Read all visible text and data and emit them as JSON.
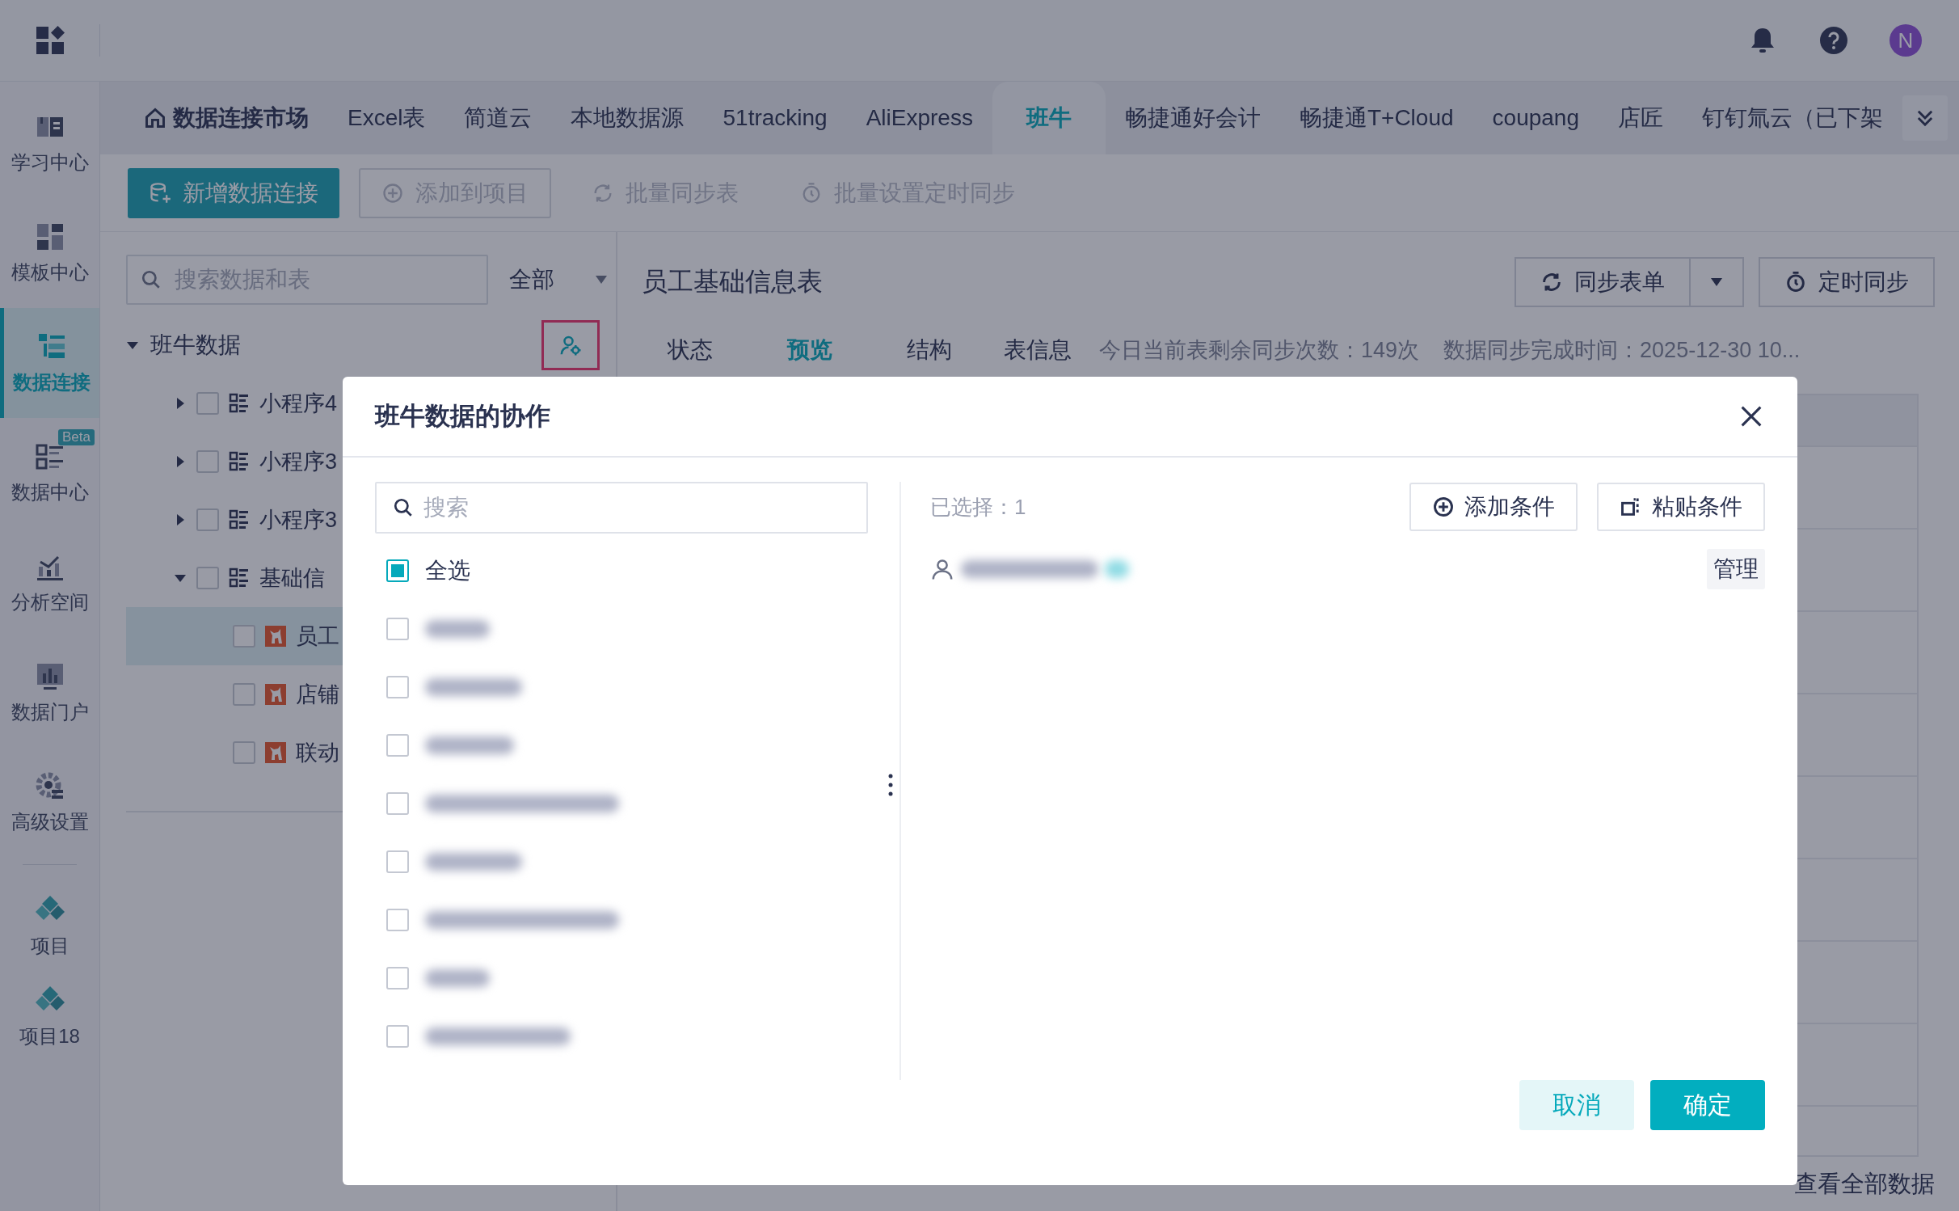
{
  "top_bar": {
    "avatar": "N"
  },
  "sidebar": {
    "items": [
      {
        "label": "学习中心",
        "kind": "nav",
        "selected": false
      },
      {
        "label": "模板中心",
        "kind": "nav",
        "selected": false
      },
      {
        "label": "数据连接",
        "kind": "nav",
        "selected": true
      },
      {
        "label": "数据中心",
        "kind": "nav",
        "selected": false,
        "badge": "Beta"
      },
      {
        "label": "分析空间",
        "kind": "nav",
        "selected": false
      },
      {
        "label": "数据门户",
        "kind": "nav",
        "selected": false
      },
      {
        "label": "高级设置",
        "kind": "nav",
        "selected": false
      },
      {
        "label": "项目",
        "kind": "project",
        "selected": false
      },
      {
        "label": "项目18",
        "kind": "project",
        "selected": false
      }
    ]
  },
  "tabs": [
    {
      "label": "数据连接市场",
      "kind": "home",
      "selected": false
    },
    {
      "label": "Excel表",
      "kind": "plain",
      "selected": false
    },
    {
      "label": "简道云",
      "kind": "plain",
      "selected": false
    },
    {
      "label": "本地数据源",
      "kind": "plain",
      "selected": false
    },
    {
      "label": "51tracking",
      "kind": "plain",
      "selected": false
    },
    {
      "label": "AliExpress",
      "kind": "plain",
      "selected": false
    },
    {
      "label": "班牛",
      "kind": "plain",
      "selected": true
    },
    {
      "label": "畅捷通好会计",
      "kind": "plain",
      "selected": false
    },
    {
      "label": "畅捷通T+Cloud",
      "kind": "plain",
      "selected": false
    },
    {
      "label": "coupang",
      "kind": "plain",
      "selected": false
    },
    {
      "label": "店匠",
      "kind": "plain",
      "selected": false
    },
    {
      "label": "钉钉氚云（已下架",
      "kind": "plain",
      "selected": false
    }
  ],
  "toolbar": [
    {
      "label": "新增数据连接",
      "kind": "primary",
      "disabled": false
    },
    {
      "label": "添加到项目",
      "kind": "outline",
      "disabled": true
    },
    {
      "label": "批量同步表",
      "kind": "text",
      "disabled": true
    },
    {
      "label": "批量设置定时同步",
      "kind": "text",
      "disabled": true
    }
  ],
  "tree_panel": {
    "search": {
      "placeholder": "搜索数据和表"
    },
    "filter": "全部",
    "root": {
      "label": "班牛数据",
      "expanded": true,
      "children": [
        {
          "label": "小程序4",
          "kind": "folder",
          "expanded": false,
          "selected": false
        },
        {
          "label": "小程序3",
          "kind": "folder",
          "expanded": false,
          "selected": false
        },
        {
          "label": "小程序3",
          "kind": "folder",
          "expanded": false,
          "selected": false
        },
        {
          "label": "基础信",
          "kind": "folder",
          "expanded": true,
          "selected": false,
          "children": [
            {
              "label": "员工",
              "kind": "table",
              "selected": true
            },
            {
              "label": "店铺",
              "kind": "table",
              "selected": false
            },
            {
              "label": "联动",
              "kind": "table",
              "selected": false
            }
          ]
        }
      ]
    }
  },
  "detail": {
    "title": "员工基础信息表",
    "sync_button": "同步表单",
    "timer_button": "定时同步",
    "subtabs": [
      {
        "label": "状态",
        "selected": false
      },
      {
        "label": "预览",
        "selected": true
      },
      {
        "label": "结构",
        "selected": false
      },
      {
        "label": "表信息",
        "selected": false
      }
    ],
    "sync_count": "今日当前表剩余同步次数：149次",
    "sync_time": "数据同步完成时间：2025-12-30 10...",
    "view_all": "查看全部数据"
  },
  "dialog": {
    "title": "班牛数据的协作",
    "search": {
      "placeholder": "搜索"
    },
    "select_all": {
      "label": "全选",
      "checked": true
    },
    "members": [
      {
        "checked": false
      },
      {
        "checked": false
      },
      {
        "checked": false
      },
      {
        "checked": false
      },
      {
        "checked": false
      },
      {
        "checked": false
      },
      {
        "checked": false
      },
      {
        "checked": false
      }
    ],
    "selected_count": "已选择：1",
    "add_condition": "添加条件",
    "paste_condition": "粘贴条件",
    "selected_members": [
      {
        "action": "管理"
      }
    ],
    "cancel": "取消",
    "confirm": "确定"
  }
}
